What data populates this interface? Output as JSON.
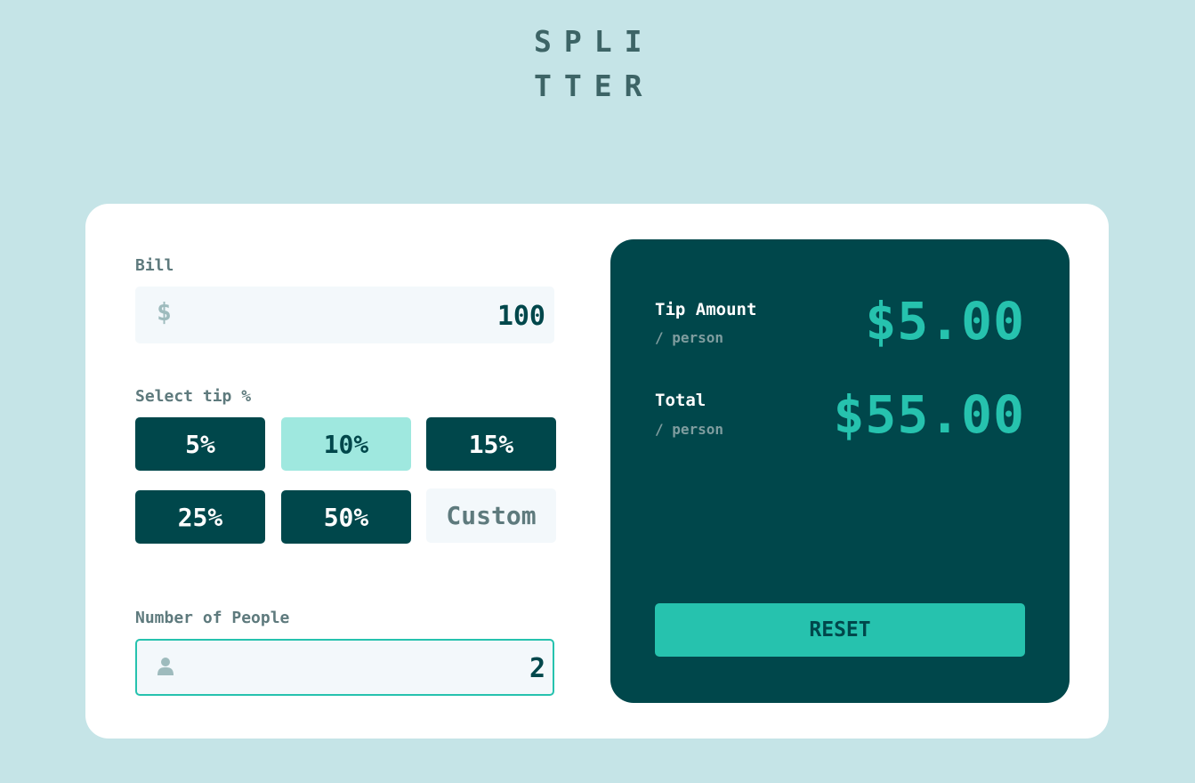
{
  "app": {
    "logo_line1": "SPLI",
    "logo_line2": "TTER"
  },
  "bill": {
    "label": "Bill",
    "currency_icon": "$",
    "value": "100"
  },
  "tip": {
    "label": "Select tip %",
    "options": [
      "5%",
      "10%",
      "15%",
      "25%",
      "50%"
    ],
    "selected": "10%",
    "custom_placeholder": "Custom"
  },
  "people": {
    "label": "Number of People",
    "icon": "person-icon",
    "value": "2"
  },
  "results": {
    "tip_title": "Tip Amount",
    "tip_sub": "/ person",
    "tip_amount": "$5.00",
    "total_title": "Total",
    "total_sub": "/ person",
    "total_amount": "$55.00",
    "reset_label": "RESET"
  },
  "colors": {
    "background": "#c5e4e7",
    "dark_cyan": "#00474b",
    "accent": "#26c2ae",
    "selected_tip": "#9fe8df"
  }
}
